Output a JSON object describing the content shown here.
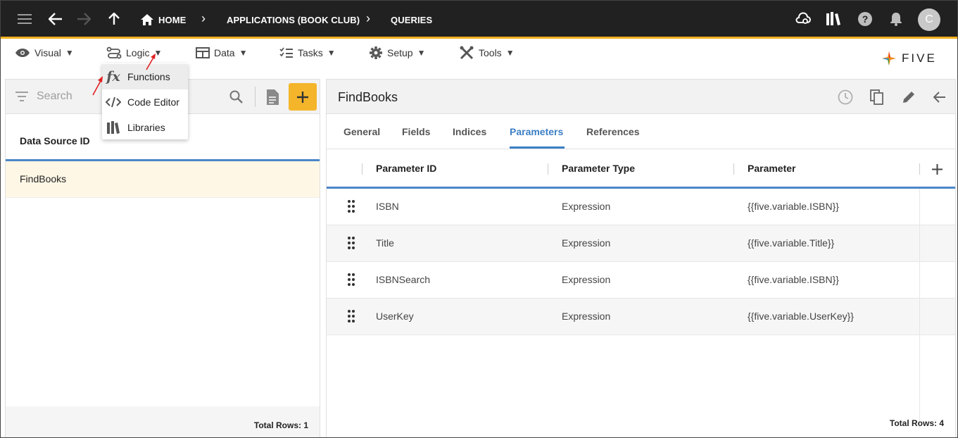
{
  "topbar": {
    "crumbs": [
      "HOME",
      "APPLICATIONS (BOOK CLUB)",
      "QUERIES"
    ],
    "avatar_letter": "C"
  },
  "menubar": {
    "items": [
      "Visual",
      "Logic",
      "Data",
      "Tasks",
      "Setup",
      "Tools"
    ],
    "logo_text": "FIVE"
  },
  "logic_menu": {
    "items": [
      "Functions",
      "Code Editor",
      "Libraries"
    ]
  },
  "left_panel": {
    "search_placeholder": "Search",
    "column_header": "Data Source ID",
    "rows": [
      "FindBooks"
    ],
    "total_rows": "Total Rows: 1"
  },
  "right_panel": {
    "title": "FindBooks",
    "tabs": [
      "General",
      "Fields",
      "Indices",
      "Parameters",
      "References"
    ],
    "active_tab": "Parameters",
    "columns": [
      "Parameter ID",
      "Parameter Type",
      "Parameter"
    ],
    "rows": [
      {
        "id": "ISBN",
        "type": "Expression",
        "parameter": "{{five.variable.ISBN}}"
      },
      {
        "id": "Title",
        "type": "Expression",
        "parameter": "{{five.variable.Title}}"
      },
      {
        "id": "ISBNSearch",
        "type": "Expression",
        "parameter": "{{five.variable.ISBN}}"
      },
      {
        "id": "UserKey",
        "type": "Expression",
        "parameter": "{{five.variable.UserKey}}"
      }
    ],
    "total_rows": "Total Rows: 4"
  },
  "colors": {
    "topbar": "#212121",
    "accent": "#f2b01e",
    "add_button": "#f5b52b",
    "active_tab": "#3d7fc6",
    "selected_row": "#fff7e6",
    "annotation_arrow": "#e02020"
  }
}
